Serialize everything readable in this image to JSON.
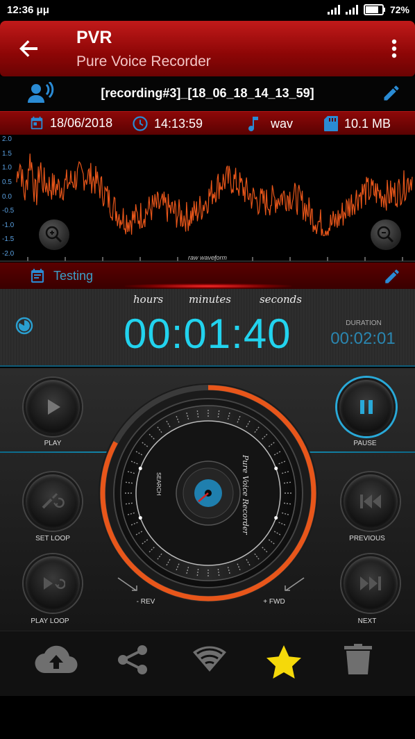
{
  "status_bar": {
    "time": "12:36 μμ",
    "battery": "72%"
  },
  "app_bar": {
    "title": "PVR",
    "subtitle": "Pure Voice Recorder"
  },
  "recording": {
    "name": "[recording#3]_[18_06_18_14_13_59]"
  },
  "info": {
    "date": "18/06/2018",
    "time": "14:13:59",
    "format": "wav",
    "size": "10.1 MB"
  },
  "waveform": {
    "y_ticks": [
      "2.0",
      "1.5",
      "1.0",
      "0.5",
      "0.0",
      "-0.5",
      "-1.0",
      "-1.5",
      "-2.0"
    ],
    "caption": "raw waveform",
    "color": "#e8561a"
  },
  "note": {
    "text": "Testing"
  },
  "timer": {
    "units": {
      "hours": "hours",
      "minutes": "minutes",
      "seconds": "seconds"
    },
    "value": "00:01:40",
    "duration_label": "DURATION",
    "duration_value": "00:02:01"
  },
  "controls": {
    "play": "PLAY",
    "pause": "PAUSE",
    "set_loop": "SET LOOP",
    "previous": "PREVIOUS",
    "play_loop": "PLAY LOOP",
    "next": "NEXT",
    "rev": "- REV",
    "fwd": "+ FWD",
    "search": "SEARCH",
    "brand": "Pure Voice Recorder",
    "progress": 0.83
  },
  "bottom_bar": {
    "icons": [
      "cloud-upload-icon",
      "share-icon",
      "wifi-icon",
      "star-icon",
      "delete-icon"
    ],
    "accent": "#f5d90a"
  },
  "colors": {
    "primary": "#a80e0e",
    "cyan": "#22d3ee",
    "orange": "#e8561a"
  }
}
